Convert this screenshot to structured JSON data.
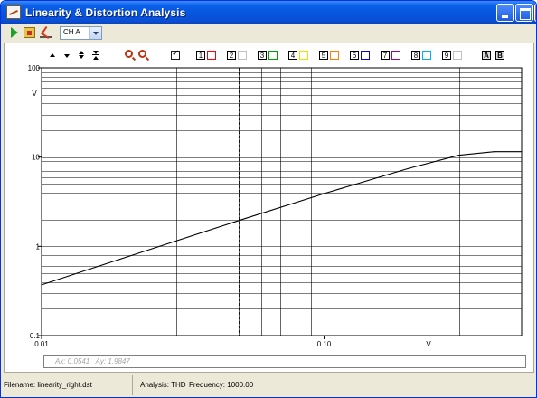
{
  "window": {
    "title": "Linearity & Distortion Analysis"
  },
  "toolbar": {
    "channel_select_value": "CH A",
    "icons": [
      "play-icon",
      "open-icon",
      "meter-icon"
    ]
  },
  "graph_toolbar": {
    "icons": [
      "arrow-up-icon",
      "arrow-down-icon",
      "expand-icon",
      "compress-icon",
      "zoom-in-icon",
      "zoom-out-icon"
    ],
    "show_all_checked": true,
    "channels": [
      {
        "label": "1",
        "color": "#ff0000"
      },
      {
        "label": "2",
        "color": "#c0c0c0"
      },
      {
        "label": "3",
        "color": "#00a000"
      },
      {
        "label": "4",
        "color": "#f0e000"
      },
      {
        "label": "5",
        "color": "#ff8000"
      },
      {
        "label": "6",
        "color": "#0000ff"
      },
      {
        "label": "7",
        "color": "#a000a0"
      },
      {
        "label": "8",
        "color": "#00b0f0"
      },
      {
        "label": "9",
        "color": "#c0c0c0"
      }
    ],
    "ab_buttons": [
      "A",
      "B"
    ]
  },
  "chart_data": {
    "type": "line",
    "x_scale": "log",
    "y_scale": "log",
    "xlim": [
      0.01,
      0.5
    ],
    "ylim": [
      0.1,
      100
    ],
    "x_ticks": [
      "0.01",
      "0.10"
    ],
    "x_unit": "V",
    "y_ticks": [
      "100",
      "10",
      "1",
      "0.1"
    ],
    "y_unit": "V",
    "grid": true,
    "cursor_x": 0.05,
    "series": [
      {
        "color": "#000000",
        "x": [
          0.01,
          0.02,
          0.05,
          0.1,
          0.2,
          0.3,
          0.4,
          0.5
        ],
        "y": [
          0.37,
          0.76,
          1.95,
          3.9,
          7.5,
          10.5,
          11.5,
          11.5
        ]
      }
    ],
    "cursor_readout": {
      "ax": "Ax: 0.0541",
      "ay": "Ay: 1.9847"
    }
  },
  "status": {
    "filename": "Filename: linearity_right.dst",
    "analysis": "Analysis: THD",
    "frequency": "Frequency: 1000.00"
  }
}
